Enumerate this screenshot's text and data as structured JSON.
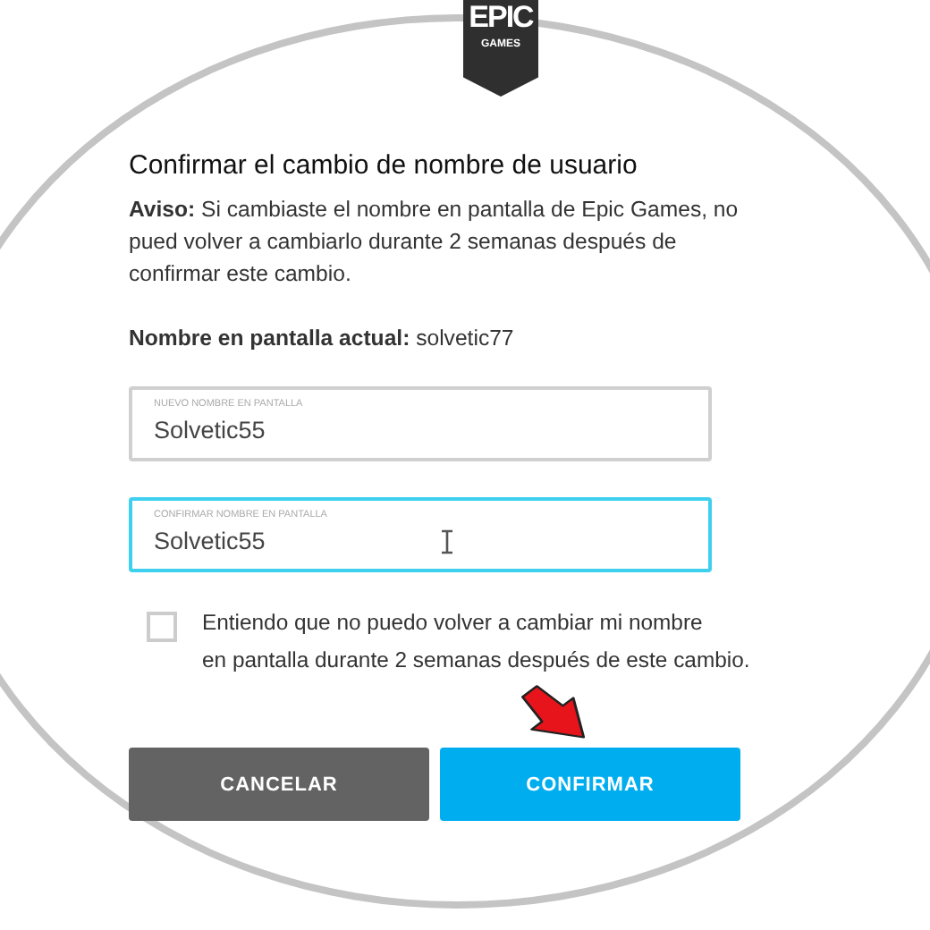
{
  "logo": {
    "top": "EPIC",
    "bottom": "GAMES"
  },
  "title": "Confirmar el cambio de nombre de usuario",
  "notice": "**Aviso:** Si cambiaste el nombre en pantalla de Epic Games, no pued volver a cambiarlo durante 2 semanas después de confirmar este cambio.",
  "current_name": "**Nombre en pantalla actual:** solvetic77",
  "fields": [
    {
      "label": "NUEVO NOMBRE EN PANTALLA",
      "value": "Solvetic55",
      "focused": false
    },
    {
      "label": "CONFIRMAR NOMBRE EN PANTALLA",
      "value": "Solvetic55",
      "focused": true
    }
  ],
  "agreement": {
    "text": "Entiendo que no puedo volver a cambiar mi nombre en pantalla durante 2 semanas después de este cambio.",
    "checked": false
  },
  "buttons": [
    {
      "label": "CANCELAR",
      "kind": "secondary"
    },
    {
      "label": "CONFIRMAR",
      "kind": "primary"
    }
  ]
}
